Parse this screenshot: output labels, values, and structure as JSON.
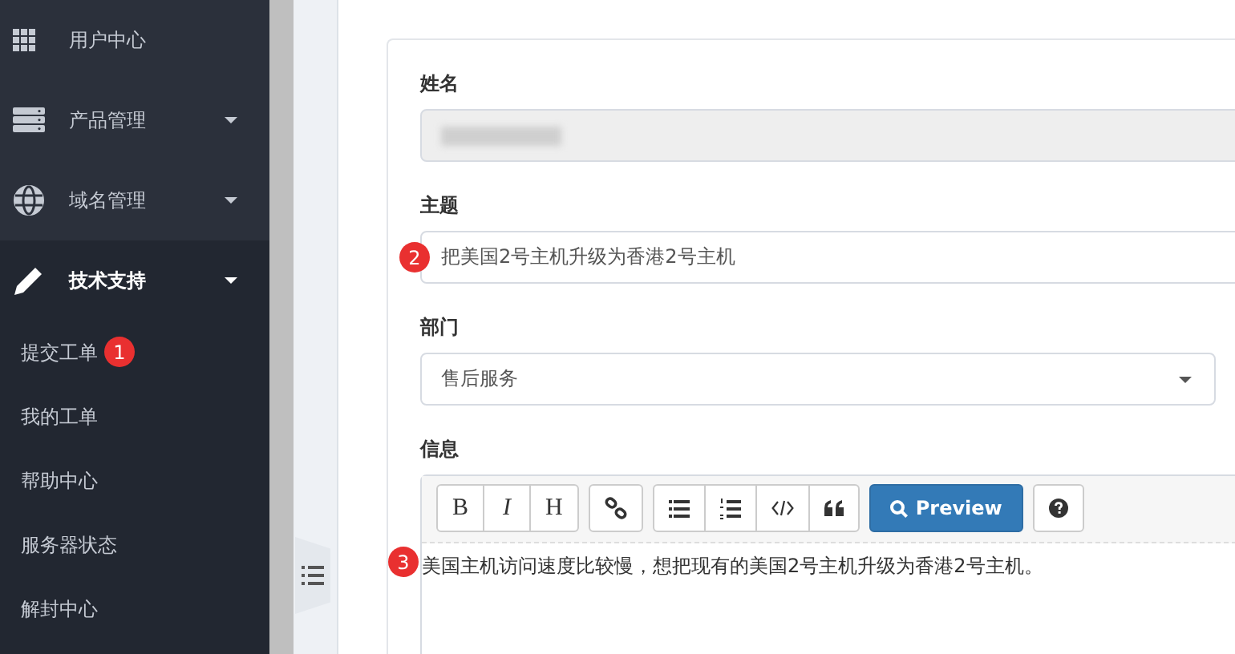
{
  "sidebar": {
    "items": [
      {
        "kind": "link",
        "label": "用户中心"
      },
      {
        "kind": "menu",
        "label": "产品管理",
        "expanded": false
      },
      {
        "kind": "menu",
        "label": "域名管理",
        "expanded": false
      },
      {
        "kind": "menu",
        "label": "技术支持",
        "expanded": true,
        "children": [
          {
            "label": "提交工单",
            "badge": "1"
          },
          {
            "label": "我的工单"
          },
          {
            "label": "帮助中心"
          },
          {
            "label": "服务器状态"
          },
          {
            "label": "解封中心"
          }
        ]
      }
    ]
  },
  "form": {
    "name": {
      "label": "姓名",
      "disabled": true
    },
    "subject": {
      "label": "主题",
      "value": "把美国2号主机升级为香港2号主机",
      "badge": "2"
    },
    "department": {
      "label": "部门",
      "value": "售后服务"
    },
    "message": {
      "label": "信息",
      "badge": "3",
      "value": "美国主机访问速度比较慢，想把现有的美国2号主机升级为香港2号主机。",
      "toolbar": [
        [
          {
            "kind": "text",
            "label": "B"
          },
          {
            "kind": "text",
            "label": "I"
          },
          {
            "kind": "text",
            "label": "H"
          }
        ],
        [
          {
            "kind": "icon"
          }
        ],
        [
          {
            "kind": "icon"
          },
          {
            "kind": "icon"
          },
          {
            "kind": "icon"
          },
          {
            "kind": "icon"
          }
        ],
        [
          {
            "kind": "primary",
            "label": "Preview"
          }
        ],
        [
          {
            "kind": "icon"
          }
        ]
      ]
    }
  }
}
